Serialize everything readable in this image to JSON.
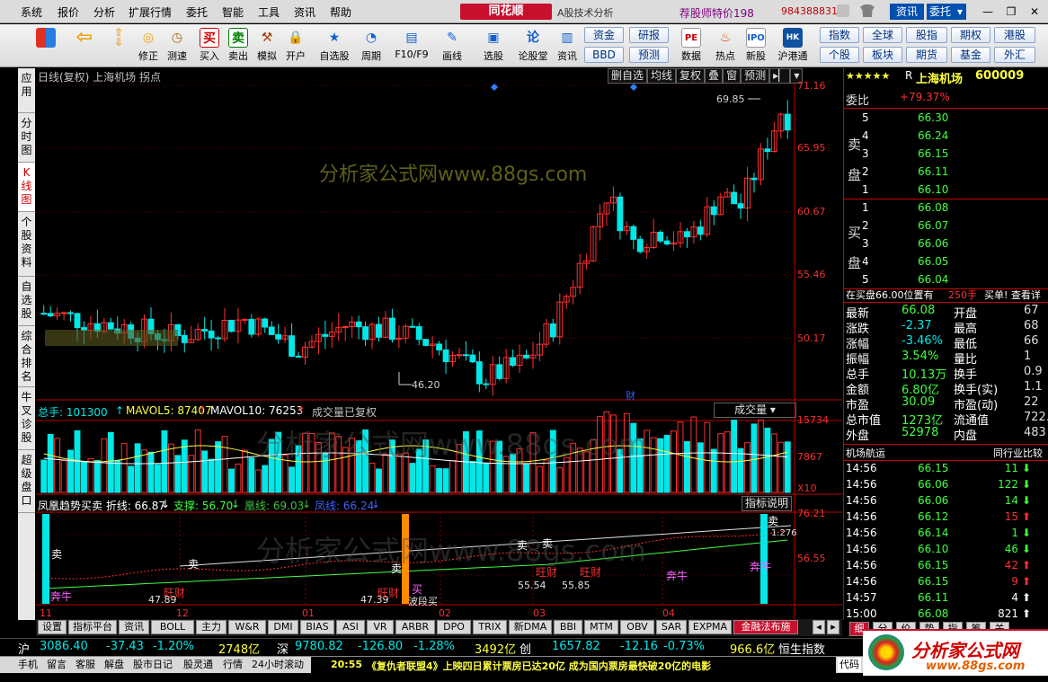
{
  "menu": [
    "系统",
    "报价",
    "分析",
    "扩展行情",
    "委托",
    "智能",
    "工具",
    "资讯",
    "帮助"
  ],
  "brand": "同花顺",
  "brand_sub": "A股技术分析",
  "promo": "荐股师特价198",
  "account": "984388831",
  "top_ctrls": {
    "news": "资讯",
    "trade": "委托",
    "trade_arrow": "▾"
  },
  "toolbar": {
    "buttons": [
      "买入",
      "卖出",
      "模拟",
      "开户",
      "自选股",
      "周期",
      "F10/F9",
      "画线",
      "选股",
      "论股堂",
      "资讯",
      "数据",
      "热点",
      "新股",
      "沪港通"
    ],
    "fund": "资金",
    "bbd": "BBD",
    "research": "研报",
    "forecast": "预测",
    "menu2": [
      "修正",
      "测速"
    ],
    "grid": [
      "指数",
      "全球",
      "股指",
      "期权",
      "港股",
      "个股",
      "板块",
      "期货",
      "基金",
      "外汇"
    ]
  },
  "left_tabs": [
    "应用",
    "分时图",
    "K线图",
    "个股资料",
    "自选股",
    "综合排名",
    "牛叉诊股",
    "超级盘口"
  ],
  "chart": {
    "title": "日线(复权)  上海机场  拐点",
    "btns": [
      "删自选",
      "均线",
      "复权",
      "叠",
      "窗",
      "预测"
    ],
    "watermark": "分析家公式网www.88gs.com",
    "y_main": [
      "71.16",
      "65.95",
      "60.67",
      "55.46",
      "50.17"
    ],
    "hi_label": "69.85",
    "lo_label": "46.20",
    "cai": "财",
    "vol_title": "总手: 101300",
    "vol_mavol5": "MAVOL5: 87407",
    "vol_mavol10": "MAVOL10: 76253",
    "vol_note": "成交量已复权",
    "vol_select": "成交量",
    "y_vol": [
      "15734",
      "7867",
      "X10"
    ],
    "ind_title": "凤凰趋势买卖  折线: 66.87",
    "ind_support": "支撑: 56.70",
    "ind_phoenix": "凰线: 69.03",
    "ind_fengxian": "凤线: 66.24",
    "ind_help": "指标说明",
    "y_ind": [
      "76.21",
      "56.55"
    ],
    "x_labels": [
      "11",
      "12",
      "01",
      "02",
      "03",
      "04"
    ],
    "ind_marks": [
      "卖",
      "奔牛",
      "47.89",
      "旺财",
      "47.39",
      "买",
      "波段买",
      "55.54",
      "55.85",
      "卖",
      "奔牛",
      "1.276"
    ]
  },
  "bottom_tabs": [
    "设置",
    "指标平台",
    "资讯",
    "BOLL",
    "主力",
    "W&R",
    "DMI",
    "BIAS",
    "ASI",
    "VR",
    "ARBR",
    "DPO",
    "TRIX",
    "新DMA",
    "BBI",
    "MTM",
    "OBV",
    "SAR",
    "EXPMA",
    "金融法布施"
  ],
  "stock": {
    "stars": "★★★★★",
    "flag": "R",
    "name": "上海机场",
    "code": "600009",
    "weibi_label": "委比",
    "weibi": "+79.37%",
    "sell_label": "卖盘",
    "buy_label": "买盘",
    "asks": [
      [
        "5",
        "66.30"
      ],
      [
        "4",
        "66.24"
      ],
      [
        "3",
        "66.15"
      ],
      [
        "2",
        "66.11"
      ],
      [
        "1",
        "66.10"
      ]
    ],
    "bids": [
      [
        "1",
        "66.08"
      ],
      [
        "2",
        "66.07"
      ],
      [
        "3",
        "66.06"
      ],
      [
        "4",
        "66.05"
      ],
      [
        "5",
        "66.04"
      ]
    ],
    "notice": "在买盘66.00位置有",
    "notice_vol": "250手",
    "notice_tag": "买单! 查看详",
    "stats": [
      [
        "最新",
        "66.08",
        "开盘",
        "67"
      ],
      [
        "涨跌",
        "-2.37",
        "最高",
        "68"
      ],
      [
        "涨幅",
        "-3.46%",
        "最低",
        "66"
      ],
      [
        "振幅",
        "3.54%",
        "量比",
        "1"
      ],
      [
        "总手",
        "10.13万",
        "换手",
        "0.9"
      ],
      [
        "金额",
        "6.80亿",
        "换手(实)",
        "1.1"
      ],
      [
        "市盈",
        "30.09",
        "市盈(动)",
        "22"
      ],
      [
        "总市值",
        "1273亿",
        "流通值",
        "722.6"
      ],
      [
        "外盘",
        "52978",
        "内盘",
        "483"
      ]
    ],
    "sector": "机场航运",
    "compare": "同行业比较"
  },
  "ticks": [
    [
      "14:56",
      "66.15",
      "11",
      "down"
    ],
    [
      "14:56",
      "66.06",
      "122",
      "down"
    ],
    [
      "14:56",
      "66.06",
      "14",
      "down"
    ],
    [
      "14:56",
      "66.12",
      "15",
      "up"
    ],
    [
      "14:56",
      "66.14",
      "1",
      "down"
    ],
    [
      "14:56",
      "66.10",
      "46",
      "down"
    ],
    [
      "14:56",
      "66.15",
      "42",
      "up"
    ],
    [
      "14:56",
      "66.15",
      "9",
      "up"
    ],
    [
      "14:57",
      "66.11",
      "4",
      "upw"
    ],
    [
      "15:00",
      "66.08",
      "821",
      "upw"
    ]
  ],
  "tick_tabs": [
    "细",
    "分",
    "价",
    "势",
    "指",
    "筹",
    "关"
  ],
  "ticker": {
    "sh_label": "沪",
    "sh": "3086.40",
    "sh_chg": "-37.43",
    "sh_pct": "-1.20%",
    "sh_amt": "2748亿",
    "sz_label": "深",
    "sz": "9780.82",
    "sz_chg": "-126.80",
    "sz_pct": "-1.28%",
    "sz_amt": "3492亿",
    "cy_label": "创",
    "cy": "1657.82",
    "cy_chg": "-12.16",
    "cy_pct": "-0.73%",
    "cy_amt": "966.6亿",
    "hs": "恒生指数"
  },
  "status": {
    "tabs": [
      "手机",
      "留言",
      "客服",
      "解盘",
      "股市日记",
      "股灵通",
      "行情",
      "24小时滚动"
    ],
    "news_time": "20:55",
    "news": "《复仇者联盟4》上映四日累计票房已达20亿 成为国内票房最快破20亿的电影",
    "code_btn": "代码"
  },
  "logo": {
    "text": "分析家公式网",
    "url": "www.88gs.com"
  },
  "colors": {
    "up": "#ff3030",
    "down": "#00e8e8",
    "yellow": "#ffff40",
    "accent": "#c8102e"
  }
}
